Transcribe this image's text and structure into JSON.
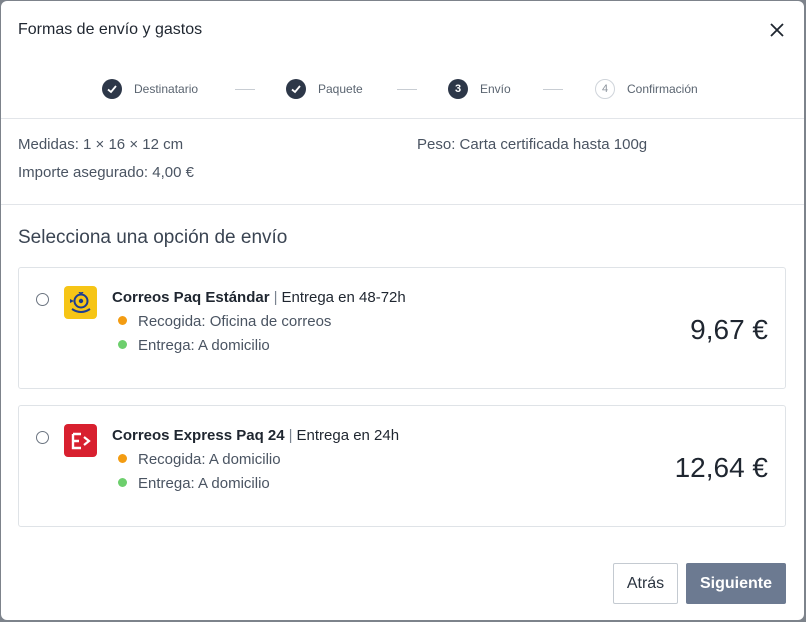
{
  "modal": {
    "title": "Formas de envío y gastos",
    "close_icon": "close-icon"
  },
  "stepper": {
    "steps": [
      {
        "label": "Destinatario",
        "state": "done",
        "marker": "✓"
      },
      {
        "label": "Paquete",
        "state": "done",
        "marker": "✓"
      },
      {
        "label": "Envío",
        "state": "active",
        "marker": "3"
      },
      {
        "label": "Confirmación",
        "state": "pending",
        "marker": "4"
      }
    ]
  },
  "package": {
    "measures": "Medidas: 1 × 16 × 12 cm",
    "weight": "Peso: Carta certificada hasta 100g",
    "insured": "Importe asegurado: 4,00 €"
  },
  "section_title": "Selecciona una opción de envío",
  "options": [
    {
      "logo_icon": "correos-post-horn-icon",
      "name": "Correos Paq Estándar",
      "separator": "|",
      "delivery_time": "Entrega en 48-72h",
      "pickup": "Recogida: Oficina de correos",
      "delivery": "Entrega: A domicilio",
      "price": "9,67 €",
      "selected": false
    },
    {
      "logo_icon": "correos-express-logo-icon",
      "name": "Correos Express Paq 24",
      "separator": "|",
      "delivery_time": "Entrega en 24h",
      "pickup": "Recogida: A domicilio",
      "delivery": "Entrega: A domicilio",
      "price": "12,64 €",
      "selected": false
    }
  ],
  "colors": {
    "pickup_dot": "#f39c12",
    "delivery_dot": "#6dcf6d",
    "primary_button": "#6c7a91",
    "step_active": "#2d3748"
  },
  "buttons": {
    "back": "Atrás",
    "next": "Siguiente"
  }
}
